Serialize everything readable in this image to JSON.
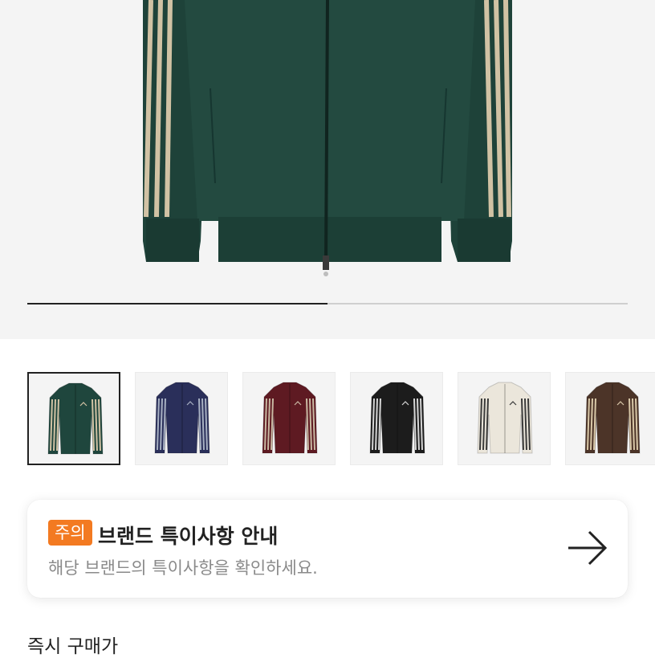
{
  "gallery": {
    "image_icon": "track-jacket-image",
    "progress": 0.5
  },
  "color_options": [
    {
      "color": "#1f463d",
      "stripe": "#d1c2a4",
      "selected": true
    },
    {
      "color": "#2a2f5a",
      "stripe": "#a7b0c2",
      "selected": false
    },
    {
      "color": "#5e1a22",
      "stripe": "#c9b9a3",
      "selected": false
    },
    {
      "color": "#1c1c1c",
      "stripe": "#d5d5d5",
      "selected": false
    },
    {
      "color": "#ebe6db",
      "stripe": "#3a3a3a",
      "selected": false
    },
    {
      "color": "#4c3428",
      "stripe": "#d9c8a8",
      "selected": false
    }
  ],
  "notice": {
    "badge": "주의",
    "title": "브랜드 특이사항 안내",
    "subtitle": "해당 브랜드의 특이사항을 확인하세요.",
    "arrow_icon": "arrow-right-icon"
  },
  "instant_buy": {
    "label": "즉시 구매가"
  },
  "colors": {
    "accent": "#f37a21",
    "text": "#222222",
    "muted": "#8a8a8a"
  }
}
